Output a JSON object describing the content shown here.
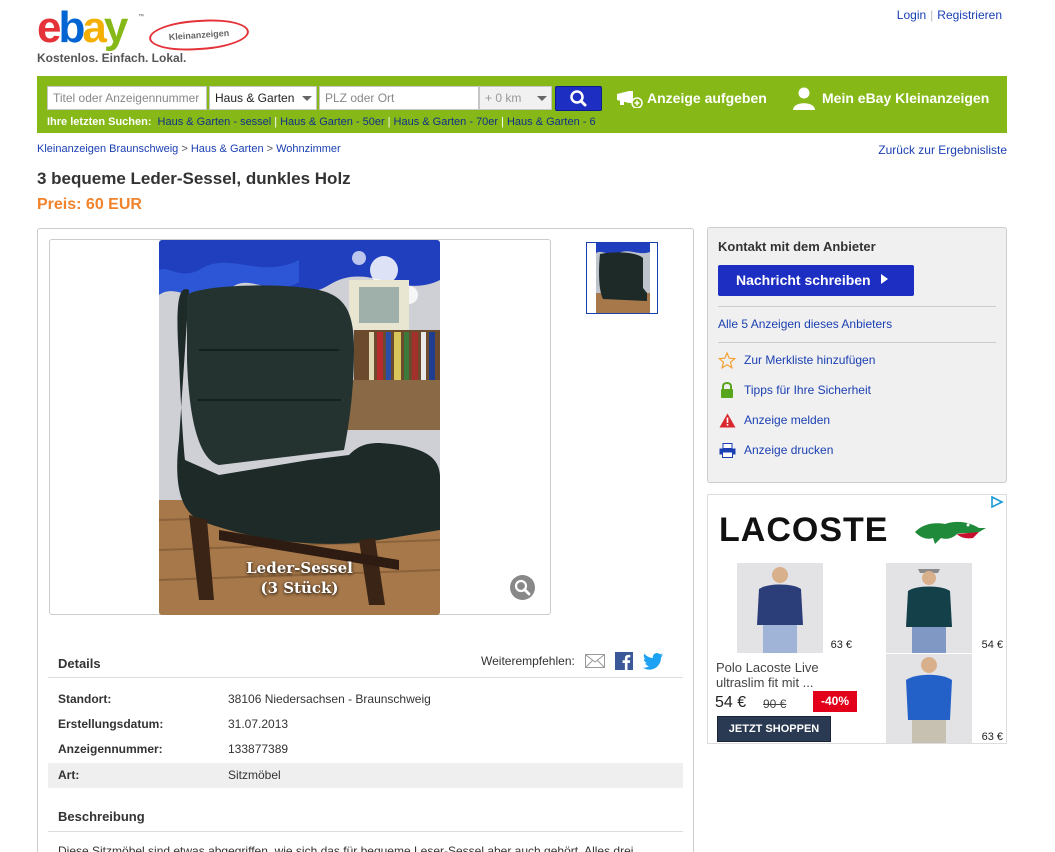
{
  "header": {
    "logo_letters": [
      "e",
      "b",
      "a",
      "y"
    ],
    "logo_sub": "Kleinanzeigen",
    "slogan": "Kostenlos. Einfach. Lokal.",
    "login": "Login",
    "register": "Registrieren"
  },
  "search": {
    "query_placeholder": "Titel oder Anzeigennummer",
    "category": "Haus & Garten",
    "location_placeholder": "PLZ oder Ort",
    "radius": "+ 0 km",
    "post_ad": "Anzeige aufgeben",
    "my_account": "Mein eBay Kleinanzeigen",
    "recent_label": "Ihre letzten Suchen:",
    "recent": [
      "Haus & Garten - sessel",
      "Haus & Garten - 50er",
      "Haus & Garten - 70er",
      "Haus & Garten - 6"
    ]
  },
  "breadcrumb": [
    "Kleinanzeigen Braunschweig",
    "Haus & Garten",
    "Wohnzimmer"
  ],
  "back_link": "Zurück zur Ergebnisliste",
  "listing": {
    "title": "3 bequeme Leder-Sessel, dunkles Holz",
    "price": "Preis: 60 EUR",
    "photo_caption_1": "Leder-Sessel",
    "photo_caption_2": "(3 Stück)"
  },
  "details": {
    "heading": "Details",
    "share_label": "Weiterempfehlen:",
    "rows": [
      {
        "key": "Standort:",
        "value": "38106 Niedersachsen - Braunschweig"
      },
      {
        "key": "Erstellungsdatum:",
        "value": "31.07.2013"
      },
      {
        "key": "Anzeigennummer:",
        "value": "133877389"
      },
      {
        "key": "Art:",
        "value": "Sitzmöbel"
      }
    ],
    "desc_heading": "Beschreibung",
    "desc_text": "Diese Sitzmöbel sind etwas abgegriffen, wie sich das für bequeme Leser-Sessel aber auch gehört. Alles drei"
  },
  "contact": {
    "heading": "Kontakt mit dem Anbieter",
    "message_button": "Nachricht schreiben",
    "all_ads": "Alle 5 Anzeigen dieses Anbieters",
    "actions": [
      "Zur Merkliste hinzufügen",
      "Tipps für Ihre Sicherheit",
      "Anzeige melden",
      "Anzeige drucken"
    ]
  },
  "ad": {
    "brand": "LACOSTE",
    "prices": [
      "63 €",
      "54 €",
      "63 €"
    ],
    "product_text": "Polo Lacoste Live ultraslim fit mit ...",
    "new_price": "54 €",
    "old_price": "90 €",
    "discount": "-40%",
    "cta": "JETZT SHOPPEN"
  },
  "colors": {
    "brand_green": "#86b817",
    "button_blue": "#1d2ec3",
    "price_orange": "#f1832d",
    "link_blue": "#1a3fb2"
  }
}
